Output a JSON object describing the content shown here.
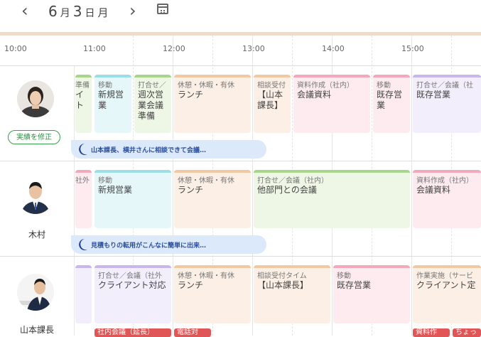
{
  "header": {
    "month": "6",
    "month_unit": "月",
    "day": "3",
    "day_unit": "日",
    "weekday": "月",
    "prev_icon": "chevron-left-icon",
    "next_icon": "chevron-right-icon",
    "calendar_icon": "calendar-icon"
  },
  "timeline": {
    "ticks": [
      "10:00",
      "11:00",
      "12:00",
      "13:00",
      "14:00",
      "15:00"
    ]
  },
  "people": [
    {
      "name": "",
      "fix_button": "実績を修正",
      "memo": "山本課長、横井さんに相談できて会議…",
      "events": [
        {
          "category": "準備",
          "title": "イト",
          "color": "#a7d58a"
        },
        {
          "category": "移動",
          "title": "新規営業",
          "color": "#9cdde8"
        },
        {
          "category": "打合せ／",
          "title": "週次営業会議準備",
          "color": "#a7d58a"
        },
        {
          "category": "休憩・休暇・有休",
          "title": "ランチ",
          "color": "#f0c9a2"
        },
        {
          "category": "相談受付",
          "title": "【山本課長】",
          "color": "#f0c9a2"
        },
        {
          "category": "資料作成（社内）",
          "title": "会議資料",
          "color": "#f2a9bb"
        },
        {
          "category": "移動",
          "title": "既存営業",
          "color": "#f2a9bb"
        },
        {
          "category": "打合せ／会議（社",
          "title": "既存営業",
          "color": "#c9b6ea"
        }
      ]
    },
    {
      "name": "木村",
      "memo": "見積もりの転用がこんなに簡単に出来…",
      "events": [
        {
          "category": "社外",
          "title": "",
          "color": "#f2a9bb"
        },
        {
          "category": "移動",
          "title": "新規営業",
          "color": "#9cdde8"
        },
        {
          "category": "休憩・休暇・有休",
          "title": "ランチ",
          "color": "#f0c9a2"
        },
        {
          "category": "打合せ／会議（社内）",
          "title": "他部門との会議",
          "color": "#a7d58a"
        },
        {
          "category": "資料作成（社内）",
          "title": "会議資料",
          "color": "#f2a9bb"
        }
      ]
    },
    {
      "name": "山本課長",
      "events": [
        {
          "category": "",
          "title": "",
          "color": "#c9b6ea"
        },
        {
          "category": "打合せ／会議（社外",
          "title": "クライアント対応",
          "color": "#c9b6ea"
        },
        {
          "category": "休憩・休暇・有休",
          "title": "ランチ",
          "color": "#f0c9a2"
        },
        {
          "category": "相談受付タイム",
          "title": "【山本課長】",
          "color": "#f0c9a2"
        },
        {
          "category": "移動",
          "title": "既存営業",
          "color": "#f2a9bb"
        },
        {
          "category": "作業実施（サービ",
          "title": "クライアント定",
          "color": "#f0c9a2"
        }
      ],
      "pills": [
        "社内会議（延長）",
        "電話対",
        "資料作",
        "ちょっ"
      ]
    }
  ]
}
